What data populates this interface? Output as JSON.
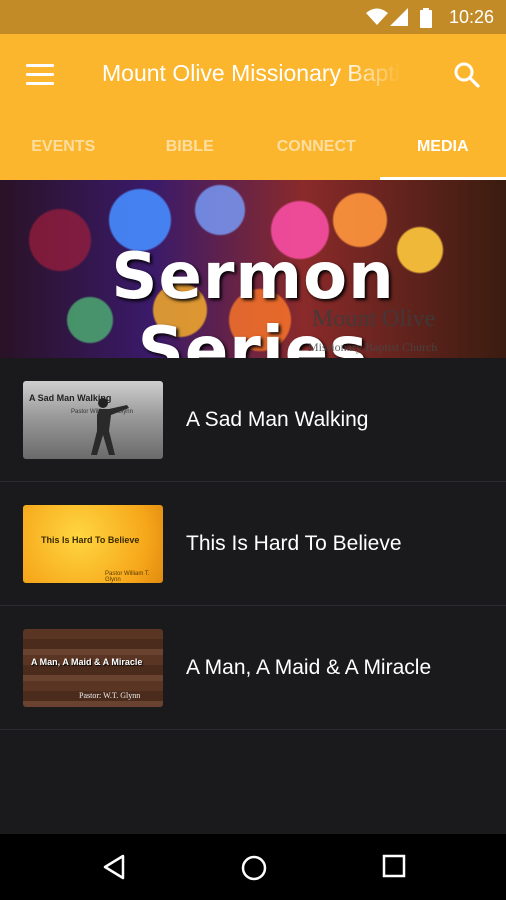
{
  "status_bar": {
    "time": "10:26"
  },
  "app_bar": {
    "title": "Mount Olive Missionary Baptist Church"
  },
  "tabs": [
    {
      "label": "EVENTS",
      "active": false
    },
    {
      "label": "BIBLE",
      "active": false
    },
    {
      "label": "CONNECT",
      "active": false
    },
    {
      "label": "MEDIA",
      "active": true
    }
  ],
  "banner": {
    "title": "Sermon Series",
    "subtitle": "Mount Olive",
    "subtitle_line2": "Missionary Baptist Church"
  },
  "sermons": [
    {
      "title": "A Sad Man Walking",
      "thumb_title": "A Sad Man Walking",
      "thumb_subtitle": "Pastor William T. Glynn"
    },
    {
      "title": "This Is Hard To Believe",
      "thumb_title": "This Is Hard To Believe",
      "thumb_subtitle": "Pastor William T. Glynn"
    },
    {
      "title": "A Man, A Maid & A Miracle",
      "thumb_title": "A Man, A Maid & A Miracle",
      "thumb_subtitle": "Pastor: W.T. Glynn"
    }
  ],
  "colors": {
    "primary": "#fbb62e",
    "status_bar": "#c28b27",
    "background": "#1a1a1d"
  }
}
